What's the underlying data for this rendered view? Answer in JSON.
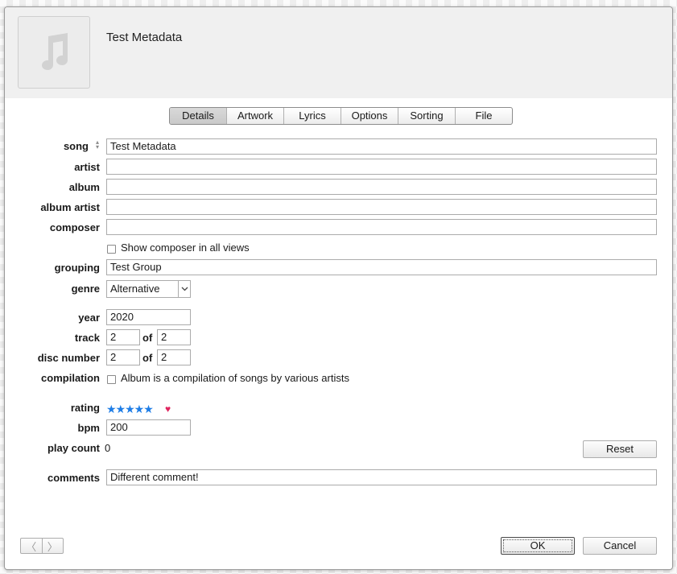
{
  "header": {
    "title": "Test Metadata",
    "artwork_icon": "music-note-icon"
  },
  "tabs": [
    "Details",
    "Artwork",
    "Lyrics",
    "Options",
    "Sorting",
    "File"
  ],
  "active_tab": "Details",
  "fields": {
    "song": {
      "label": "song",
      "value": "Test Metadata"
    },
    "artist": {
      "label": "artist",
      "value": ""
    },
    "album": {
      "label": "album",
      "value": ""
    },
    "album_artist": {
      "label": "album artist",
      "value": ""
    },
    "composer": {
      "label": "composer",
      "value": ""
    },
    "show_composer": {
      "label": "Show composer in all views",
      "checked": false
    },
    "grouping": {
      "label": "grouping",
      "value": "Test Group"
    },
    "genre": {
      "label": "genre",
      "value": "Alternative"
    },
    "year": {
      "label": "year",
      "value": "2020"
    },
    "track": {
      "label": "track",
      "number": "2",
      "of_label": "of",
      "total": "2"
    },
    "disc": {
      "label": "disc number",
      "number": "2",
      "of_label": "of",
      "total": "2"
    },
    "compilation": {
      "label": "compilation",
      "text": "Album is a compilation of songs by various artists",
      "checked": false
    },
    "rating": {
      "label": "rating",
      "stars": 5,
      "stars_text": "★★★★★",
      "loved_icon": "heart-icon",
      "heart_glyph": "♥"
    },
    "bpm": {
      "label": "bpm",
      "value": "200"
    },
    "play_count": {
      "label": "play count",
      "value": "0",
      "reset_label": "Reset"
    },
    "comments": {
      "label": "comments",
      "value": "Different comment!"
    }
  },
  "footer": {
    "prev_icon": "chevron-left-icon",
    "next_icon": "chevron-right-icon",
    "prev_glyph": "〈",
    "next_glyph": "〉",
    "ok_label": "OK",
    "cancel_label": "Cancel"
  },
  "colors": {
    "star": "#1e7de6",
    "heart": "#e0245e",
    "header_bg": "#f0f0f0"
  }
}
